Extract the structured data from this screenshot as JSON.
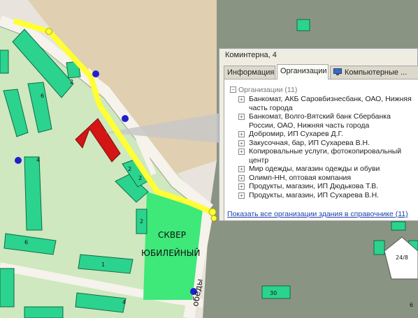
{
  "map": {
    "park_label_line1": "СКВЕР",
    "park_label_line2": "ЮБИЛЕЙНЫЙ",
    "street_label": "обеды",
    "building_numbers": [
      "6",
      "4",
      "2",
      "2",
      "2",
      "6",
      "1",
      "4",
      "30",
      "24/8",
      "6"
    ],
    "colors": {
      "ground": "#e9e3dd",
      "tan_area": "#e0cfb0",
      "dark_area": "#8a9482",
      "lawn": "#cfe8bf",
      "park": "#3ee879",
      "building": "#2cd38e",
      "selected_building": "#d41515",
      "route": "#ffff33",
      "stop": "#2020cc"
    }
  },
  "popup": {
    "title": "Коминтерна, 4",
    "tabs": [
      {
        "label": "Информация"
      },
      {
        "label": "Организации"
      },
      {
        "label": "Компьютерные ..."
      }
    ],
    "tree": {
      "root_label": "Организации (11)",
      "items": [
        "Банкомат, АКБ Саровбизнесбанк, ОАО, Нижняя часть города",
        "Банкомат, Волго-Вятский банк Сбербанка России, ОАО, Нижняя часть города",
        "Добромир, ИП Сухарев Д.Г.",
        "Закусочная, бар, ИП Сухарева В.Н.",
        "Копировальные услуги, фотокопировальный центр",
        "Мир одежды, магазин одежды и обуви",
        "Олимп-НН, оптовая компания",
        "Продукты, магазин, ИП Дюдькова Т.В.",
        "Продукты, магазин, ИП Сухарева В.Н."
      ]
    },
    "show_all_link": "Показать все организации здания в справочнике",
    "show_all_count": "(11)"
  }
}
